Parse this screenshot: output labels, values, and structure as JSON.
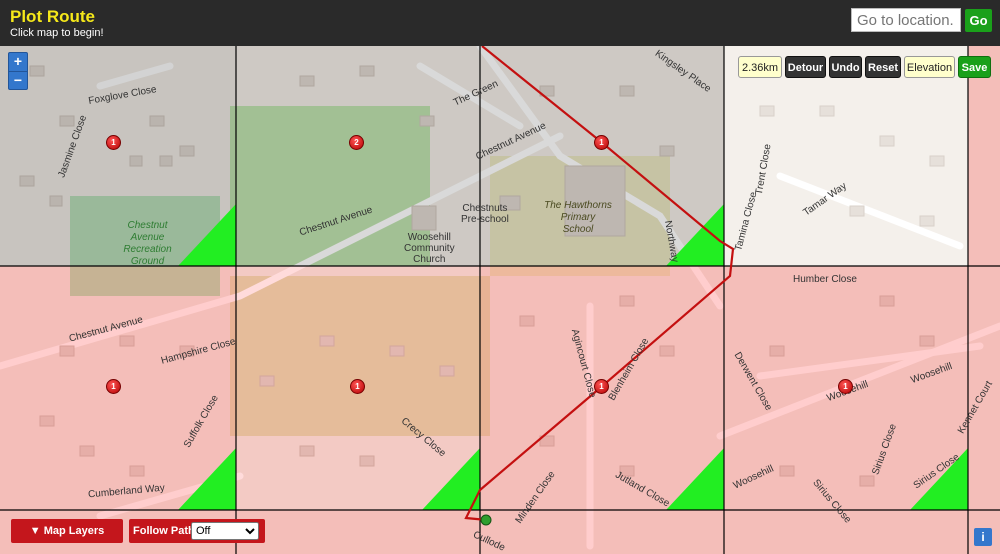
{
  "header": {
    "title": "Plot Route",
    "subtitle": "Click map to begin!",
    "location_placeholder": "Go to location...",
    "go_label": "Go"
  },
  "zoom": {
    "in": "+",
    "out": "−"
  },
  "toolbar": {
    "distance": "2.36km",
    "detour": "Detour",
    "undo": "Undo",
    "reset": "Reset",
    "elevation": "Elevation",
    "save": "Save"
  },
  "map_labels": {
    "foxglove_close": "Foxglove Close",
    "jasmine_close": "Jasmine Close",
    "the_green": "The Green",
    "kingsley_place": "Kingsley Place",
    "chestnut_avenue_1": "Chestnut Avenue",
    "chestnut_avenue_2": "Chestnut Avenue",
    "chestnut_avenue_3": "Chestnut Avenue",
    "church_1": "Woosehill",
    "church_2": "Community",
    "church_3": "Church",
    "preschool_1": "Chestnuts",
    "preschool_2": "Pre-school",
    "school_1": "The Hawthorns",
    "school_2": "Primary",
    "school_3": "School",
    "trent_close": "Trent Close",
    "tamar_way": "Tamar Way",
    "tamina_close": "Tamina Close",
    "northway": "Northway",
    "humber_close": "Humber Close",
    "hampshire_close": "Hampshire Close",
    "suffolk_close": "Suffolk Close",
    "agincourt_close": "Agincourt Close",
    "blenheim_close": "Blenheim Close",
    "derwent_close": "Derwent Close",
    "woosehill_1": "Woosehill",
    "woosehill_2": "Woosehill",
    "woosehill_3": "Woosehill",
    "crecy_close": "Crecy Close",
    "cumberland_way": "Cumberland Way",
    "minden_close": "Minden Close",
    "jutland_close": "Jutland Close",
    "sirius_close_1": "Sirius Close",
    "sirius_close_2": "Sirius Close",
    "sirius_close_3": "Sirius Close",
    "kennet_court": "Kennet Court",
    "culloden": "Cullode",
    "park_1": "Chestnut",
    "park_2": "Avenue",
    "park_3": "Recreation",
    "park_4": "Ground"
  },
  "markers": [
    "1",
    "2",
    "1",
    "1",
    "1",
    "1",
    "1"
  ],
  "bottom": {
    "layers_label": "▼ Map Layers",
    "follow_label": "Follow Paths",
    "follow_value": "Off",
    "info": "i"
  },
  "colors": {
    "route": "#c41010",
    "grid_line": "#000000",
    "overlay_red": "#ff8080",
    "overlay_gray": "#9a9a9a",
    "corner_green": "#22ee22"
  }
}
